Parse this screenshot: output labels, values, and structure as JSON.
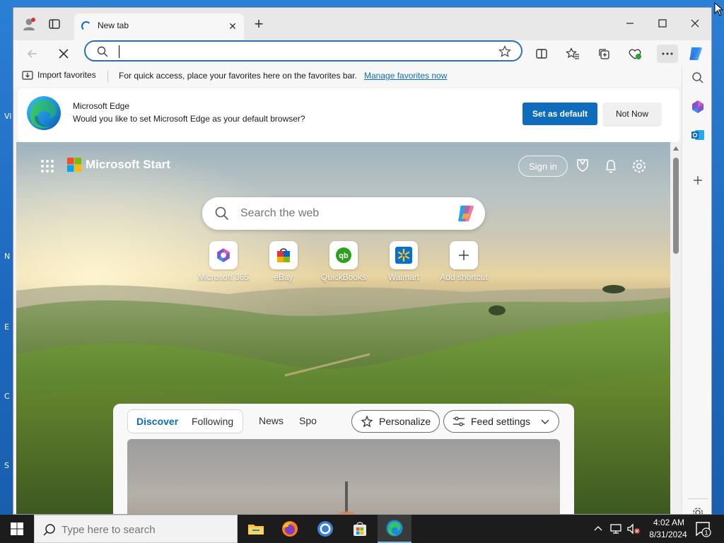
{
  "desktop": {
    "letters": [
      "Vi",
      "N",
      "E",
      "C",
      "S"
    ]
  },
  "browser": {
    "tab": {
      "title": "New tab"
    },
    "address": {
      "value": "",
      "placeholder": ""
    },
    "favorites_bar": {
      "import_label": "Import favorites",
      "message": "For quick access, place your favorites here on the favorites bar.",
      "link": "Manage favorites now"
    },
    "default_prompt": {
      "title": "Microsoft Edge",
      "message": "Would you like to set Microsoft Edge as your default browser?",
      "primary_button": "Set as default",
      "secondary_button": "Not Now"
    },
    "accent": "#0f6cbd"
  },
  "start_page": {
    "brand": "Microsoft Start",
    "sign_in": "Sign in",
    "search_placeholder": "Search the web",
    "shortcuts": [
      {
        "label": "Microsoft 365",
        "icon": "microsoft-365-icon"
      },
      {
        "label": "eBay",
        "icon": "ebay-icon"
      },
      {
        "label": "QuickBooks",
        "icon": "quickbooks-icon"
      },
      {
        "label": "Walmart",
        "icon": "walmart-icon"
      },
      {
        "label": "Add shortcut",
        "icon": "plus-icon"
      }
    ],
    "feed": {
      "tabs": [
        "Discover",
        "Following"
      ],
      "nav": [
        "News",
        "Spo"
      ],
      "personalize": "Personalize",
      "feed_settings": "Feed settings"
    }
  },
  "taskbar": {
    "search_placeholder": "Type here to search",
    "time": "4:02 AM",
    "date": "8/31/2024",
    "notification_count": "1"
  }
}
